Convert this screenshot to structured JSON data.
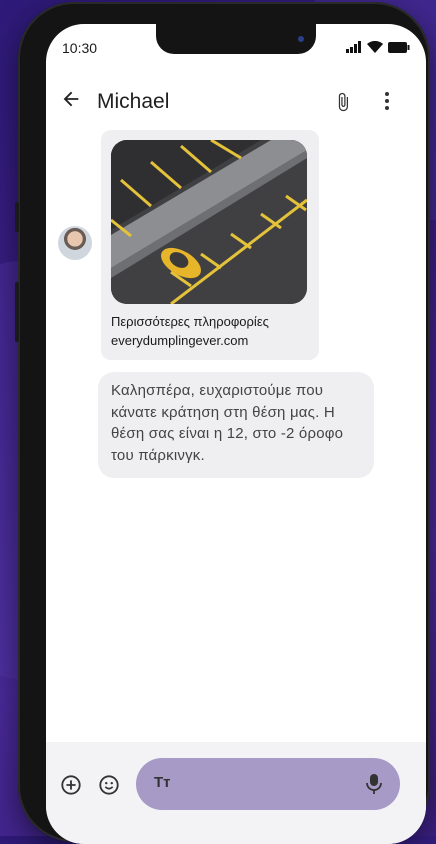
{
  "status_bar": {
    "time": "10:30"
  },
  "conversation": {
    "contact_name": "Michael"
  },
  "link_preview": {
    "title": "Περισσότερες πληροφορίες",
    "url": "everydumplingever.com"
  },
  "message": {
    "text": "Καλησπέρα, ευχαριστούμε που κάνατε κράτηση στη θέση μας. Η θέση σας είναι η 12, στο -2 όροφο του πάρκινγκ."
  },
  "composer": {
    "text_format_label": "Tт"
  },
  "icons": {
    "back": "arrow-back-icon",
    "attach": "paperclip-icon",
    "more": "more-vert-icon",
    "add": "add-circle-icon",
    "emoji": "emoji-icon",
    "mic": "mic-icon",
    "signal": "signal-icon",
    "wifi": "wifi-icon",
    "battery": "battery-icon"
  },
  "colors": {
    "background": "#3b1f86",
    "input_pill": "#a79ac7",
    "bubble": "#efeff1"
  }
}
